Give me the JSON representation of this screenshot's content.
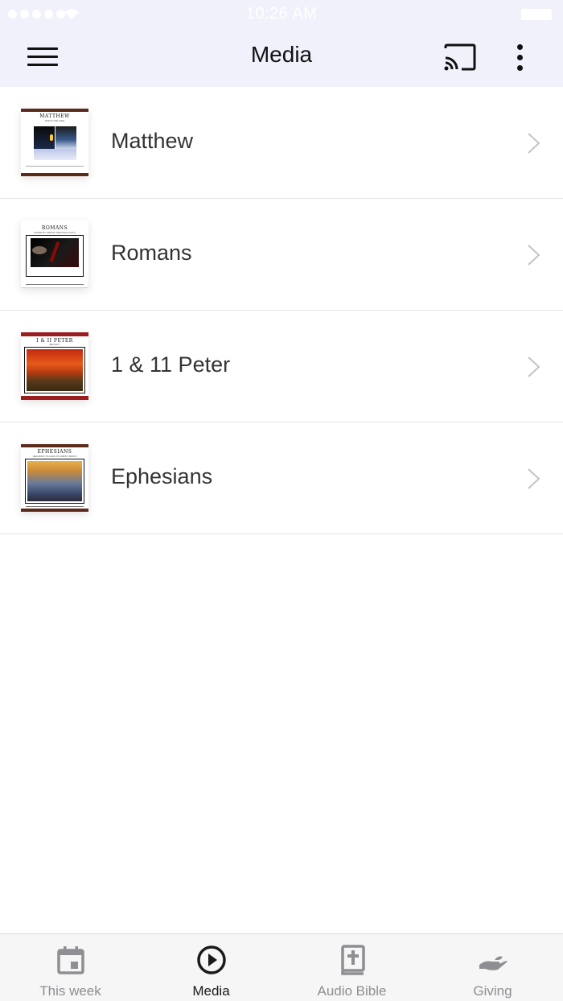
{
  "status_bar": {
    "time": "10:26 AM"
  },
  "header": {
    "title": "Media"
  },
  "media_items": [
    {
      "label": "Matthew",
      "cover_title": "MATTHEW",
      "cover_subtitle": "JESUS THE KING",
      "accent": "#5a2a1a"
    },
    {
      "label": "Romans",
      "cover_title": "ROMANS",
      "cover_subtitle": "SAVED BY GRACE THROUGH FAITH",
      "accent": "#3a4a3a"
    },
    {
      "label": "1 & 11 Peter",
      "cover_title": "I & II PETER",
      "cover_subtitle": "BE HOLY",
      "accent": "#9a1c1c"
    },
    {
      "label": "Ephesians",
      "cover_title": "EPHESIANS",
      "cover_subtitle": "HEAVENLY PLACES IN CHRIST JESUS",
      "accent": "#5a2a1a"
    }
  ],
  "tabs": [
    {
      "label": "This week",
      "icon": "calendar-icon",
      "active": false
    },
    {
      "label": "Media",
      "icon": "play-circle-icon",
      "active": true
    },
    {
      "label": "Audio Bible",
      "icon": "bible-icon",
      "active": false
    },
    {
      "label": "Giving",
      "icon": "giving-hand-icon",
      "active": false
    }
  ],
  "colors": {
    "header_bg": "#f0f1fb",
    "tab_active": "#1a1a1a",
    "tab_inactive": "#8e8e93"
  }
}
